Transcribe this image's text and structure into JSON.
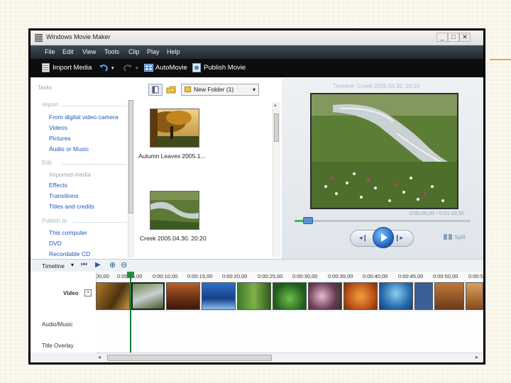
{
  "window": {
    "title": "Windows Movie Maker",
    "controls": [
      "_",
      "□",
      "✕"
    ]
  },
  "menu": [
    "File",
    "Edit",
    "View",
    "Tools",
    "Clip",
    "Play",
    "Help"
  ],
  "toolbar": {
    "import_media": "Import Media",
    "automovie": "AutoMovie",
    "publish_movie": "Publish Movie"
  },
  "tasks": {
    "heading": "Tasks",
    "import_heading": "Import",
    "import_items": [
      "From digital video camera",
      "Videos",
      "Pictures",
      "Audio or Music"
    ],
    "edit_heading": "Edit",
    "edit_items": [
      "Imported media",
      "Effects",
      "Transitions",
      "Titles and credits"
    ],
    "publish_heading": "Publish to",
    "publish_items": [
      "This computer",
      "DVD",
      "Recordable CD"
    ]
  },
  "collection": {
    "folder": "New Folder (1)",
    "items": [
      "Autumn Leaves 2005.1...",
      "Creek 2005.04.30. 20:20"
    ]
  },
  "preview": {
    "title": "Timeline: Creek 2005.04.30. 20:20",
    "time": "0:00:05,00 / 0:01:33,50",
    "split": "Split"
  },
  "timeline": {
    "label": "Timeline",
    "ticks": [
      "00,00",
      "0:00:05,00",
      "0:00:10,00",
      "0:00:15,00",
      "0:00:20,00",
      "0:00:25,00",
      "0:00:30,00",
      "0:00:35,00",
      "0:00:40,00",
      "0:00:45,00",
      "0:00:50,00",
      "0:00:5"
    ],
    "tracks": {
      "video": "Video",
      "audio": "Audio/Music",
      "title": "Title Overlay"
    }
  },
  "colors": {
    "menubar": "#22272d",
    "toolbar": "#0c0d0f",
    "link": "#1f56c4",
    "playhead": "#1b7a3a"
  }
}
